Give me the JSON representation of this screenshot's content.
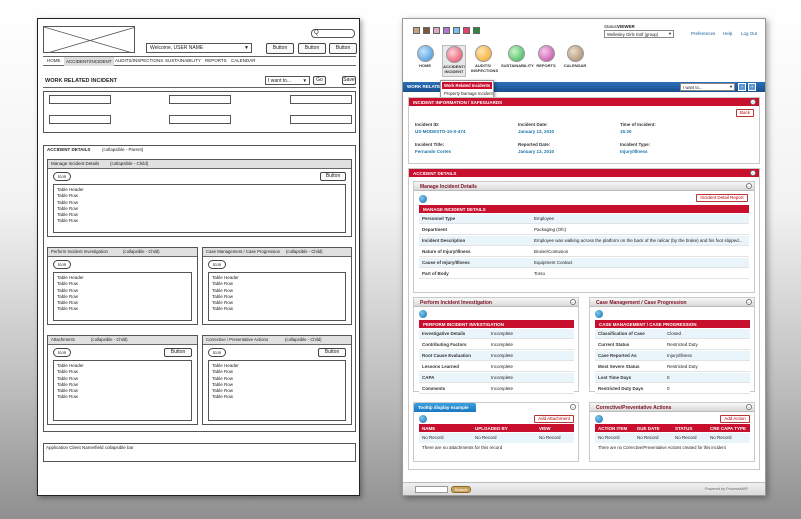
{
  "wireframe": {
    "search_btn": "Q",
    "welcome": "Welcome, USER NAME",
    "header_buttons": [
      "Button",
      "Button",
      "Button"
    ],
    "nav": [
      "HOME",
      "ACCIDENT/INCIDENT",
      "AUDITS/INSPECTIONS",
      "SUSTAINABILITY",
      "REPORTS",
      "CALENDAR"
    ],
    "work_title": "WORK RELATED INCIDENT",
    "dropdown": "I want to...",
    "go": "Go",
    "save": "Save",
    "accident_details": "ACCIDENT DETAILS",
    "accident_note": "(collapsible - Parent)",
    "manage": {
      "title": "Manage Incident Details",
      "note": "(collapsible - Child)",
      "pill": "Icon",
      "button": "Button",
      "table": [
        "Table Header",
        "Table Row",
        "Table Row",
        "Table Row",
        "Table Row",
        "Table Row"
      ]
    },
    "perform": {
      "title": "Perform Incident Investigation",
      "note": "(collapsible - Child)",
      "pill": "Icon",
      "table": [
        "Table Header",
        "Table Row",
        "Table Row",
        "Table Row",
        "Table Row",
        "Table Row"
      ]
    },
    "case": {
      "title": "Case Management / Case Progression",
      "note": "(collapsible - Child)",
      "pill": "Icon",
      "table": [
        "Table Header",
        "Table Row",
        "Table Row",
        "Table Row",
        "Table Row",
        "Table Row"
      ]
    },
    "attach": {
      "title": "Attachments",
      "note": "(collapsible - Child)",
      "pill": "Icon",
      "button": "Button",
      "table": [
        "Table Header",
        "Table Row",
        "Table Row",
        "Table Row",
        "Table Row",
        "Table Row"
      ]
    },
    "corrective": {
      "title": "Corrective / Preventative Actions",
      "note": "(collapsible - Child)",
      "pill": "Icon",
      "button": "Button",
      "table": [
        "Table Header",
        "Table Row",
        "Table Row",
        "Table Row",
        "Table Row",
        "Table Row"
      ]
    },
    "footer_note": "Application Client Name/field collapsible bar"
  },
  "mockup": {
    "status_label": "Status:",
    "status_value": "VIEWER",
    "client": "Wellesley Girls Golf (group)",
    "links": [
      "Preferences",
      "Help",
      "Log Out"
    ],
    "swatches": [
      "#c8a27a",
      "#7a5a3a",
      "#e0a8c0",
      "#b07ad0",
      "#7ac0f0",
      "#e8406a",
      "#2a8a3a"
    ],
    "nav": [
      {
        "label": "HOME",
        "color": "#3a8fd6"
      },
      {
        "label": "ACCIDENT/ INCIDENT",
        "color": "#e0405a"
      },
      {
        "label": "AUDITS/ INSPECTIONS",
        "color": "#f0a020"
      },
      {
        "label": "SUSTAINABILITY",
        "color": "#30b050"
      },
      {
        "label": "REPORTS",
        "color": "#c040a0"
      },
      {
        "label": "CALENDAR",
        "color": "#a08060"
      }
    ],
    "menu": [
      "Work Related Incidents",
      "Property Damage Incident",
      "Environmental Incidents"
    ],
    "bar_title": "WORK RELATED INCIDENT",
    "dropdown": "I want to...",
    "incident_header": "INCIDENT INFORMATION / SAFEGUARDS",
    "back": "Back",
    "incident_id_label": "Incident ID:",
    "incident_id": "US-MODESTO-10-X-474",
    "incident_date_label": "Incident Date:",
    "incident_date": "January 13, 2010",
    "time_label": "Time of Incident:",
    "time": "15:20",
    "title_label": "Incident Title:",
    "title": "Fernando Cortes",
    "reported_label": "Reported Date:",
    "reported": "January 13, 2010",
    "type_label": "Incident Type:",
    "type": "Injury/Illness",
    "accident_details": "ACCIDENT DETAILS",
    "manage_title": "Manage Incident Details",
    "detail_report": "Incident Detail Report",
    "manage_header": "MANAGE INCIDENT DETAILS",
    "manage_rows": [
      [
        "Personnel Type",
        "Employee"
      ],
      [
        "Department",
        "Packaging (Ofc)"
      ],
      [
        "Incident Description",
        "Employee was walking across the platform on the back of the railcar (by the brake) and his foot slipped..."
      ],
      [
        "Nature of Injury/Illness",
        "Bruise/Contusion"
      ],
      [
        "Cause of Injury/Illness",
        "Equipment Contact"
      ],
      [
        "Part of Body",
        "Torso"
      ]
    ],
    "perform_title": "Perform Incident Investigation",
    "perform_header": "PERFORM INCIDENT INVESTIGATION",
    "perform_rows": [
      [
        "Investigative Details",
        "Incomplete"
      ],
      [
        "Contributing Factors",
        "Incomplete"
      ],
      [
        "Root Cause Evaluation",
        "Incomplete"
      ],
      [
        "Lessons Learned",
        "Incomplete"
      ],
      [
        "CAPA",
        "Incomplete"
      ],
      [
        "Comments",
        "Incomplete"
      ]
    ],
    "case_title": "Case Management / Case Progression",
    "case_header": "CASE MANAGEMENT / CASE PROGRESSION",
    "case_rows": [
      [
        "Classification of Case",
        "Closed"
      ],
      [
        "Current Status",
        "Restricted Duty"
      ],
      [
        "Case Reported As",
        "Injury/Illness"
      ],
      [
        "Most Severe Status",
        "Restricted Duty"
      ],
      [
        "Lost Time Days",
        "0"
      ],
      [
        "Restricted Duty Days",
        "0"
      ]
    ],
    "tooltip": "Tooltip display example",
    "add_attachment": "Add Attachment",
    "attach_cols": [
      "NAME",
      "UPLOADED BY",
      "VIEW"
    ],
    "attach_row": [
      "No Record",
      "No Record",
      "No Record"
    ],
    "attach_empty": "There are no attachments for this record",
    "corrective_title": "Corrective/Preventative Actions",
    "add_action": "Add Action",
    "corr_cols": [
      "ACTION ITEM",
      "DUE DATE",
      "STATUS",
      "CRE CAPA TYPE"
    ],
    "corr_row": [
      "No Record",
      "No Record",
      "No Record",
      "No Record"
    ],
    "corr_empty": "There are no Corrective/Preventative Actions created for this incident",
    "footer_search": "Search",
    "powered": "Powered by ProcessMAP"
  }
}
